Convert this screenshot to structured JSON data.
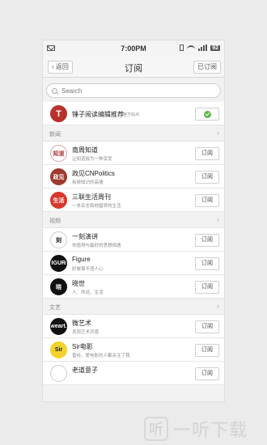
{
  "status": {
    "time": "7:00PM",
    "battery": "92"
  },
  "nav": {
    "back_label": "返回",
    "title": "订阅",
    "subscribed_label": "已订阅"
  },
  "search": {
    "placeholder": "Search"
  },
  "featured": {
    "name": "锤子阅读编辑推荐",
    "tag": "官方站点",
    "avatar_glyph": "T"
  },
  "button_label": "订阅",
  "sections": [
    {
      "label": "新闻",
      "items": [
        {
          "name": "南周知道",
          "desc": "让知道成为一种享受",
          "avatar": "知道",
          "avatar_bg": "#ffffff",
          "avatar_fg": "#a33",
          "border": "#d9a3a3"
        },
        {
          "name": "政见CNPolitics",
          "desc": "拆掉知识的高墙",
          "avatar": "政见",
          "avatar_bg": "#9e3a2d",
          "avatar_fg": "#ffffff",
          "border": "#9e3a2d"
        },
        {
          "name": "三联生活周刊",
          "desc": "一本杂志和他倡导的生活",
          "avatar": "生活",
          "avatar_bg": "#d8382b",
          "avatar_fg": "#ffffff",
          "border": "#d8382b"
        }
      ]
    },
    {
      "label": "视频",
      "items": [
        {
          "name": "一刻演讲",
          "desc": "你值得与最好的思想相遇",
          "avatar": "刻",
          "avatar_bg": "#ffffff",
          "avatar_fg": "#222",
          "border": "#cccccc"
        },
        {
          "name": "Figure",
          "desc": "好故事不违人心",
          "avatar": "FIGURE",
          "avatar_bg": "#111111",
          "avatar_fg": "#ffffff",
          "border": "#111111"
        },
        {
          "name": "晓世",
          "desc": "人、命运、生活",
          "avatar": "晓",
          "avatar_bg": "#111111",
          "avatar_fg": "#ffffff",
          "border": "#111111"
        }
      ]
    },
    {
      "label": "文艺",
      "items": [
        {
          "name": "微艺术",
          "desc": "发现艺术灵感",
          "avatar": "weart.",
          "avatar_bg": "#111111",
          "avatar_fg": "#ffffff",
          "border": "#111111"
        },
        {
          "name": "Sir电影",
          "desc": "曾经、爱电影的人都关注了我",
          "avatar": "Sir",
          "avatar_bg": "#f4d22b",
          "avatar_fg": "#111111",
          "border": "#f4d22b"
        },
        {
          "name": "老道意子",
          "desc": "",
          "avatar": "",
          "avatar_bg": "#ffffff",
          "avatar_fg": "#222",
          "border": "#cccccc"
        }
      ]
    }
  ],
  "watermark": {
    "logo": "听",
    "text": "一听下载"
  },
  "colors": {
    "accent_green": "#5fb74b",
    "featured_red": "#b8312a"
  }
}
